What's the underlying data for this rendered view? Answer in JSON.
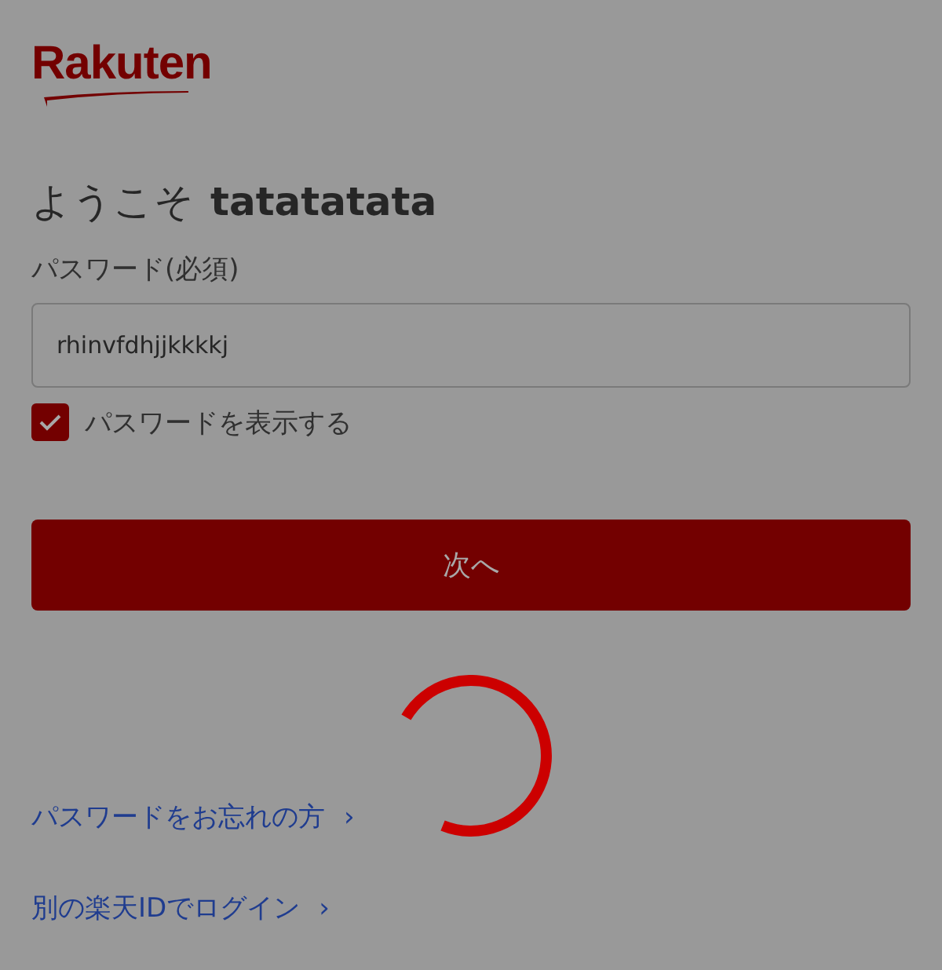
{
  "logo": "Rakuten",
  "heading": {
    "greeting": "ようこそ",
    "name": "tatatatata"
  },
  "password": {
    "label": "パスワード(必須)",
    "value": "rhinvfdhjjkkkkj"
  },
  "show_password": {
    "label": "パスワードを表示する",
    "checked": true
  },
  "next_button": "次へ",
  "links": [
    {
      "label": "パスワードをお忘れの方",
      "chevron": "›"
    },
    {
      "label": "別の楽天IDでログイン",
      "chevron": "›"
    }
  ]
}
